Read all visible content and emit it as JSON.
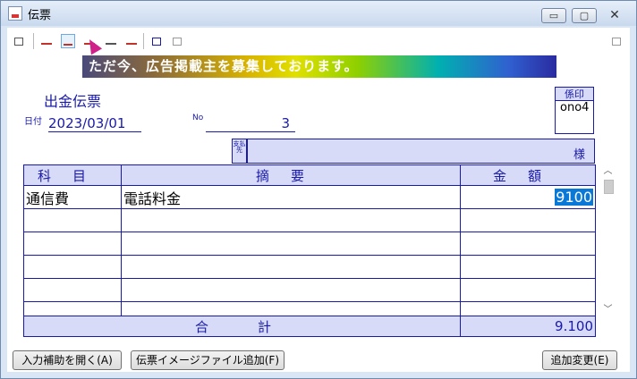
{
  "window": {
    "title": "伝票",
    "minimize": "▭",
    "maximize": "▢",
    "close": "✕"
  },
  "banner": {
    "text": "ただ今、広告掲載主を募集しております。"
  },
  "slip": {
    "title": "出金伝票",
    "date_label": "日付",
    "date_value": "2023/03/01",
    "no_label": "No",
    "no_value": "3",
    "stamp_label": "係印",
    "stamp_value": "ono4",
    "payee_label": "支払先",
    "payee_suffix": "様"
  },
  "table": {
    "headers": [
      "科目",
      "摘要",
      "金額"
    ],
    "rows": [
      {
        "account": "通信費",
        "description": "電話料金",
        "amount": "9100"
      },
      {
        "account": "",
        "description": "",
        "amount": ""
      },
      {
        "account": "",
        "description": "",
        "amount": ""
      },
      {
        "account": "",
        "description": "",
        "amount": ""
      },
      {
        "account": "",
        "description": "",
        "amount": ""
      },
      {
        "account": "",
        "description": "",
        "amount": ""
      }
    ],
    "total_label": "合　計",
    "total_value": "9.100"
  },
  "buttons": {
    "input_help": "入力補助を開く(A)",
    "add_image": "伝票イメージファイル追加(F)",
    "add_change": "追加変更(E)"
  },
  "colors": {
    "accent": "#1a1aa8",
    "header_fill": "#d7dbf7",
    "selection": "#0a78d7"
  }
}
